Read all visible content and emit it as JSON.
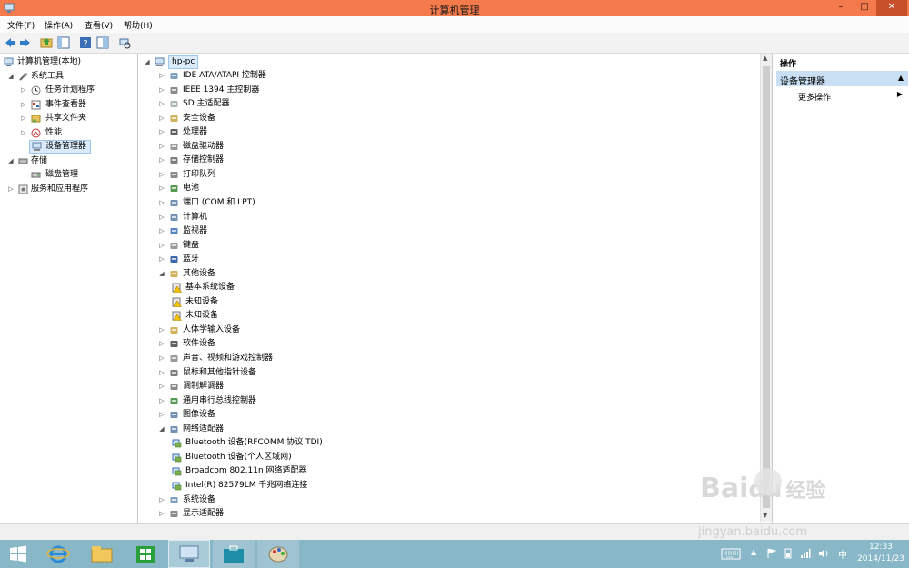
{
  "window": {
    "title": "计算机管理",
    "minimize": "–",
    "maximize": "□",
    "close": "✕"
  },
  "menu": [
    "文件(F)",
    "操作(A)",
    "查看(V)",
    "帮助(H)"
  ],
  "left_tree": {
    "root": "计算机管理(本地)",
    "system_tools": "系统工具",
    "items": [
      "任务计划程序",
      "事件查看器",
      "共享文件夹",
      "性能",
      "设备管理器"
    ],
    "storage": "存储",
    "disk_mgmt": "磁盘管理",
    "services": "服务和应用程序"
  },
  "device_tree": {
    "root": "hp-pc",
    "categories": [
      "IDE ATA/ATAPI 控制器",
      "IEEE 1394 主控制器",
      "SD 主适配器",
      "安全设备",
      "处理器",
      "磁盘驱动器",
      "存储控制器",
      "打印队列",
      "电池",
      "端口 (COM 和 LPT)",
      "计算机",
      "监视器",
      "键盘",
      "蓝牙",
      "其他设备"
    ],
    "other_devices": [
      "基本系统设备",
      "未知设备",
      "未知设备"
    ],
    "categories2": [
      "人体学输入设备",
      "软件设备",
      "声音、视频和游戏控制器",
      "鼠标和其他指针设备",
      "调制解调器",
      "通用串行总线控制器",
      "图像设备",
      "网络适配器"
    ],
    "network_adapters": [
      "Bluetooth 设备(RFCOMM 协议 TDI)",
      "Bluetooth 设备(个人区域网)",
      "Broadcom 802.11n 网络适配器",
      "Intel(R) 82579LM 千兆网络连接"
    ],
    "categories3": [
      "系统设备",
      "显示适配器"
    ]
  },
  "actions": {
    "header": "操作",
    "section": "设备管理器",
    "more": "更多操作"
  },
  "taskbar": {
    "time": "12:33",
    "date": "2014/11/23",
    "ime": "中"
  },
  "watermark": {
    "brand": "Bai",
    "brand2": "du",
    "brand_cn": "经验",
    "url": "jingyan.baidu.com"
  },
  "colors": {
    "titlebar": "#f47a4c",
    "taskbar": "#88b7c8",
    "action_header": "#c9dff3"
  }
}
